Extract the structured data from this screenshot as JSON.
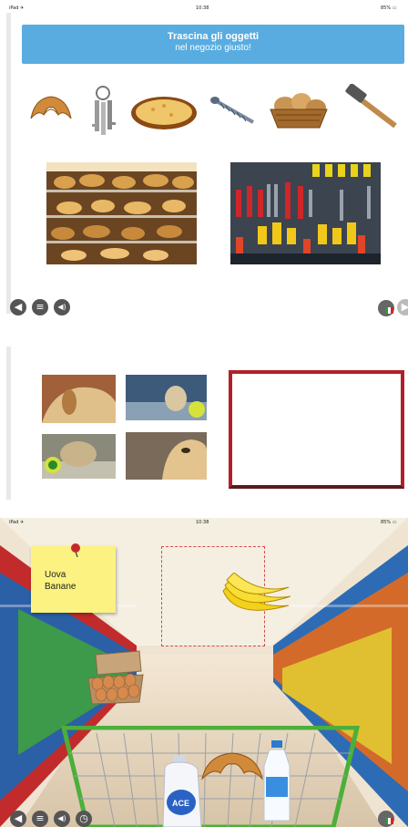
{
  "screen1": {
    "status_left": "iPad ✈",
    "status_time": "10:38",
    "status_right": "85% ▭",
    "banner_title": "Trascina gli oggetti",
    "banner_subtitle": "nel negozio giusto!",
    "items": [
      "croissant",
      "keys",
      "pizza",
      "screw",
      "bread-basket",
      "hammer"
    ],
    "shops": [
      "bakery",
      "hardware-store"
    ]
  },
  "screen2": {
    "tiles": [
      "puppy-top-left",
      "kitten-top-right",
      "kitten-bottom-left",
      "puppy-bottom-right"
    ]
  },
  "screen3": {
    "status_left": "iPad ✈",
    "status_time": "10:38",
    "status_right": "85% ▭",
    "note_line1": "Uova",
    "note_line2": "Banane",
    "cart_items": [
      "bleach-bottle",
      "croissant",
      "milk-bottle"
    ]
  },
  "nav": {
    "back_icon": "◀",
    "menu_icon": "≡",
    "audio_icon": "◀)",
    "timer_icon": "◷"
  },
  "colors": {
    "banner": "#58ace0",
    "frame": "#b02028",
    "note": "#fbf281",
    "cart": "#4caf3a"
  }
}
